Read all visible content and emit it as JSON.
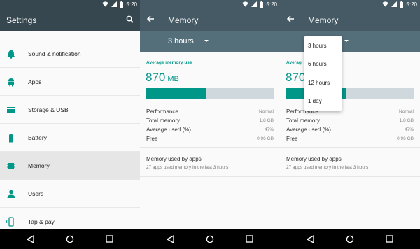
{
  "status": {
    "time": "5:20"
  },
  "panel1": {
    "title": "Settings",
    "items": [
      {
        "label": "Sound & notification",
        "icon": "bell-icon"
      },
      {
        "label": "Apps",
        "icon": "android-icon"
      },
      {
        "label": "Storage & USB",
        "icon": "storage-icon"
      },
      {
        "label": "Battery",
        "icon": "battery-icon"
      },
      {
        "label": "Memory",
        "icon": "memory-icon",
        "active": true
      },
      {
        "label": "Users",
        "icon": "person-icon"
      },
      {
        "label": "Tap & pay",
        "icon": "tap-pay-icon"
      }
    ]
  },
  "memory": {
    "title": "Memory",
    "spinner_value": "3 hours",
    "avg_label": "Average memory use",
    "avg_value": "870",
    "avg_unit": "MB",
    "usage_fraction": 0.47,
    "stats": [
      {
        "key": "Performance",
        "value": "Normal"
      },
      {
        "key": "Total memory",
        "value": "1.8 GB"
      },
      {
        "key": "Average used (%)",
        "value": "47%"
      },
      {
        "key": "Free",
        "value": "0.96 GB"
      }
    ],
    "apps_title": "Memory used by apps",
    "apps_sub": "27 apps used memory in the last 3 hours"
  },
  "panel3": {
    "avg_label_partial": "Averag",
    "avg_value_partial": "870",
    "dropdown_options": [
      "3 hours",
      "6 hours",
      "12 hours",
      "1 day"
    ]
  },
  "colors": {
    "accent": "#009688",
    "toolbar": "#455a64",
    "toolbar_dark": "#37474f"
  }
}
